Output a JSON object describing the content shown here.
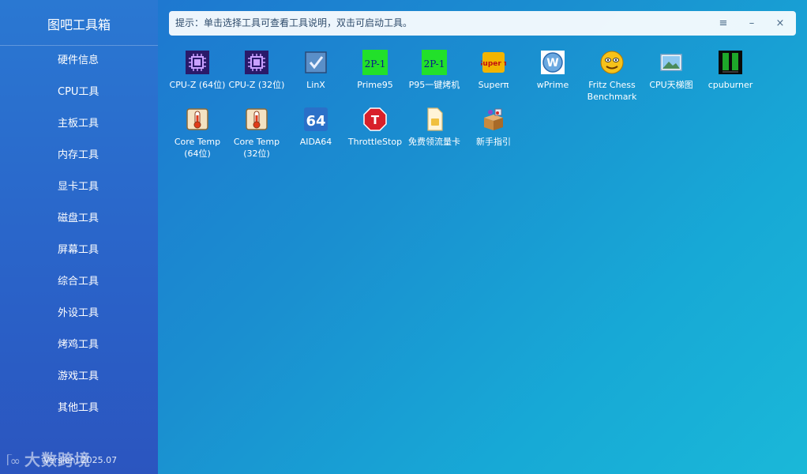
{
  "app": {
    "title": "图吧工具箱",
    "version": "Version: 2025.07"
  },
  "watermark": {
    "text": "大数跨境"
  },
  "tip": {
    "text": "提示：单击选择工具可查看工具说明，双击可启动工具。"
  },
  "window_controls": {
    "menu": "≡",
    "minimize": "–",
    "close": "×"
  },
  "menu": [
    "硬件信息",
    "CPU工具",
    "主板工具",
    "内存工具",
    "显卡工具",
    "磁盘工具",
    "屏幕工具",
    "综合工具",
    "外设工具",
    "烤鸡工具",
    "游戏工具",
    "其他工具"
  ],
  "tools": [
    {
      "label": "CPU-Z (64位)",
      "icon": "cpu-z-icon"
    },
    {
      "label": "CPU-Z (32位)",
      "icon": "cpu-z-icon"
    },
    {
      "label": "LinX",
      "icon": "linx-check-icon"
    },
    {
      "label": "Prime95",
      "icon": "prime95-icon"
    },
    {
      "label": "P95一键烤机",
      "icon": "prime95-icon"
    },
    {
      "label": "Superπ",
      "icon": "superpi-icon"
    },
    {
      "label": "wPrime",
      "icon": "wprime-icon"
    },
    {
      "label": "Fritz Chess Benchmark",
      "icon": "fritz-smiley-icon"
    },
    {
      "label": "CPU天梯图",
      "icon": "picture-icon"
    },
    {
      "label": "cpuburner",
      "icon": "cpuburner-icon"
    },
    {
      "label": "Core Temp (64位)",
      "icon": "thermometer-icon"
    },
    {
      "label": "Core Temp (32位)",
      "icon": "thermometer-icon"
    },
    {
      "label": "AIDA64",
      "icon": "aida64-icon"
    },
    {
      "label": "ThrottleStop",
      "icon": "stop-sign-icon"
    },
    {
      "label": "免费领流量卡",
      "icon": "sim-card-icon"
    },
    {
      "label": "新手指引",
      "icon": "guide-box-icon"
    }
  ],
  "icon_texts": {
    "aida": "64",
    "stop": "T",
    "superpi": "Super π",
    "wprime": "W",
    "prime": "2P-1"
  },
  "colors": {
    "accent": "#1a8fd0",
    "sidebar": "#2a6ac8",
    "prime_green": "#22e02a"
  }
}
